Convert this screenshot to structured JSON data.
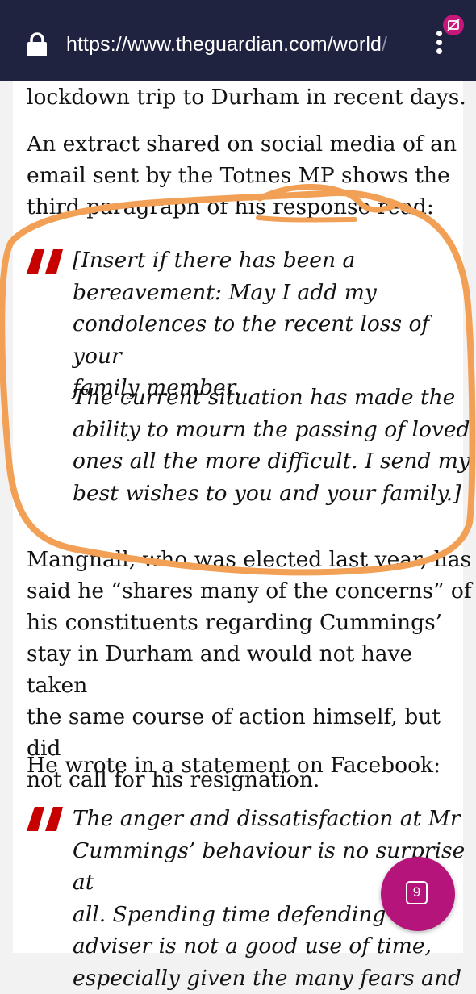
{
  "browser": {
    "url_main": "https://www.theguardian.com/world",
    "url_faded": "/",
    "lock_icon": "lock-icon",
    "menu_icon": "more-vert-icon",
    "badge_icon": "incognito-badge-icon"
  },
  "article": {
    "p0": "lockdown trip to Durham in recent days.",
    "p1": [
      "An extract shared on social media of an",
      "email sent by the Totnes MP shows the",
      "third paragraph of his response read:"
    ],
    "quote1a": [
      "[Insert if there has been a",
      "bereavement: May I add my",
      "condolences to the recent loss of your",
      "family member."
    ],
    "quote1b": [
      "The current situation has made the",
      "ability to mourn the passing of loved",
      "ones all the more difficult. I send my",
      "best wishes to you and your family.]"
    ],
    "p2": [
      "Mangnall, who was elected last year, has",
      "said he “shares many of the concerns” of",
      "his constituents regarding Cummings’",
      "stay in Durham and would not have taken",
      "the same course of action himself, but did",
      "not call for his resignation."
    ],
    "p3": "He wrote in a statement on Facebook:",
    "quote2": [
      "The anger and dissatisfaction at Mr",
      "Cummings’ behaviour is no surprise at",
      "all. Spending time defending an",
      "adviser is not a good use of time,",
      "especially given the many fears and"
    ]
  },
  "fab": {
    "count": "9",
    "icon": "tabs-count-icon"
  },
  "colors": {
    "topbar": "#1f2340",
    "accent": "#c70000",
    "fab": "#b5157a",
    "annotation": "#f2a055"
  }
}
